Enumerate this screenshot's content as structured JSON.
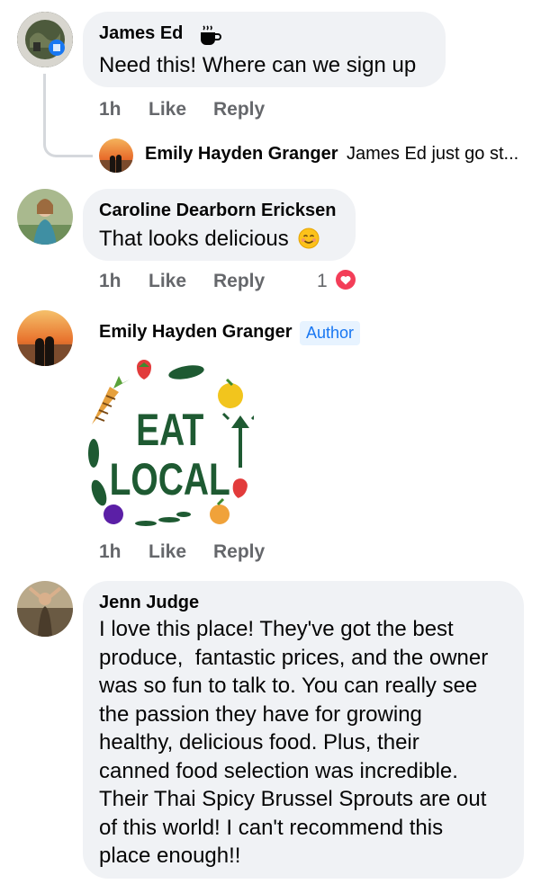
{
  "comments": [
    {
      "author": "James Ed",
      "text": "Need this! Where can we sign up",
      "time": "1h",
      "like": "Like",
      "reply": "Reply",
      "badge_icon": "coffee-cup-icon",
      "reply_preview": {
        "author": "Emily Hayden Granger",
        "text": "James Ed just go st..."
      }
    },
    {
      "author": "Caroline Dearborn Ericksen",
      "text": "That looks delicious",
      "emoji": "😊",
      "time": "1h",
      "like": "Like",
      "reply": "Reply",
      "reaction_count": "1",
      "reaction_icon": "heart-reaction-icon"
    },
    {
      "author": "Emily Hayden Granger",
      "badge": "Author",
      "image": {
        "line1": "EAT",
        "line2": "LOCAL"
      },
      "time": "1h",
      "like": "Like",
      "reply": "Reply"
    },
    {
      "author": "Jenn Judge",
      "lines": [
        "I love this place! They've got the best",
        "produce,  fantastic prices, and the owner",
        "was so fun to talk to. You can really see",
        "the passion they have for growing",
        "healthy, delicious food. Plus, their",
        "canned food selection was incredible.",
        "Their Thai Spicy Brussel Sprouts are out",
        "of this world! I can't recommend this",
        "place enough!!"
      ]
    }
  ],
  "colors": {
    "bubble": "#f0f2f5",
    "meta": "#65676b",
    "author_badge_bg": "#e7f3ff",
    "author_badge_text": "#1877f2",
    "reaction_heart": "#f33e58",
    "eat_local_green": "#1e5a32"
  }
}
